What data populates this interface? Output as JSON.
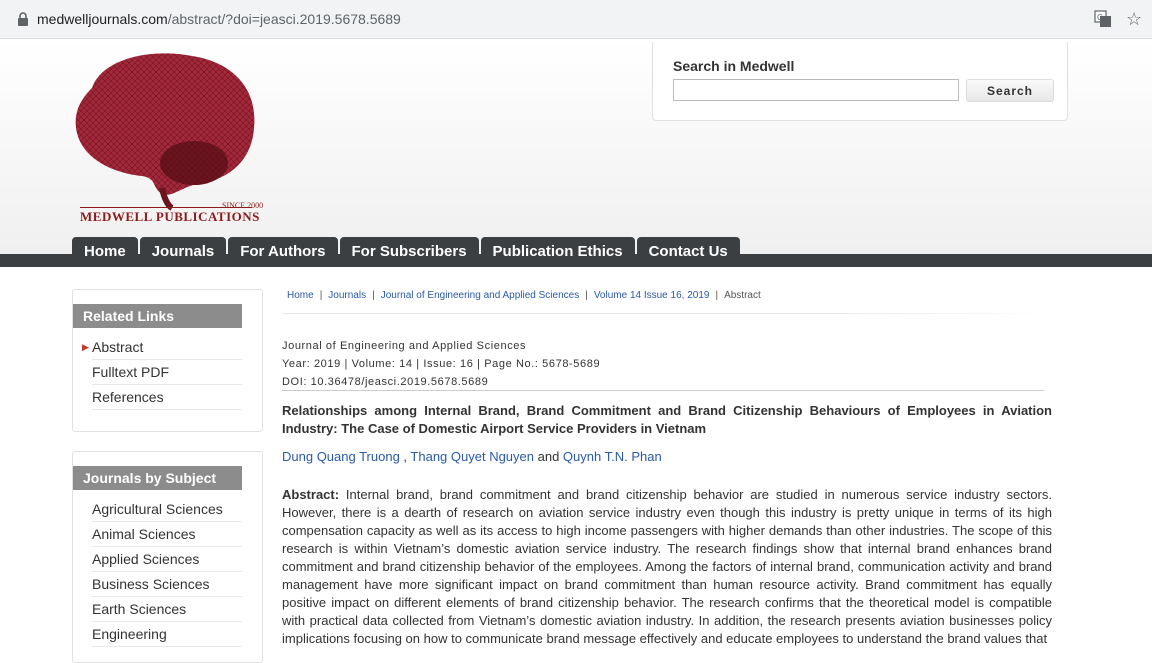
{
  "browser": {
    "url_host": "medwelljournals.com",
    "url_path": "/abstract/?doi=jeasci.2019.5678.5689"
  },
  "logo": {
    "since": "SINCE 2000",
    "name": "MEDWELL PUBLICATIONS"
  },
  "search": {
    "title": "Search in Medwell",
    "button": "Search",
    "value": ""
  },
  "nav": [
    "Home",
    "Journals",
    "For Authors",
    "For Subscribers",
    "Publication Ethics",
    "Contact Us"
  ],
  "related_links": {
    "title": "Related Links",
    "items": [
      "Abstract",
      "Fulltext PDF",
      "References"
    ]
  },
  "journals_by_subject": {
    "title": "Journals by Subject",
    "items": [
      "Agricultural Sciences",
      "Animal Sciences",
      "Applied Sciences",
      "Business Sciences",
      "Earth Sciences",
      "Engineering"
    ]
  },
  "breadcrumb": [
    "Home",
    "Journals",
    "Journal of Engineering and Applied Sciences",
    "Volume 14 Issue 16, 2019",
    "Abstract"
  ],
  "article": {
    "journal": "Journal of Engineering and Applied Sciences",
    "year_line": "Year: 2019 | Volume: 14 | Issue: 16 | Page No.: 5678-5689",
    "doi": "DOI: 10.36478/jeasci.2019.5678.5689",
    "title": "Relationships among Internal Brand, Brand Commitment and Brand Citizenship Behaviours of Employees in Aviation Industry: The Case of Domestic Airport Service Providers in Vietnam",
    "authors": [
      "Dung Quang Truong",
      "Thang Quyet Nguyen",
      "Quynh T.N. Phan"
    ],
    "author_sep": " , ",
    "author_and": " and ",
    "abstract_label": "Abstract:",
    "abstract_text": " Internal brand, brand commitment and brand citizenship behavior are studied in numerous service industry sectors. However, there is a dearth of research on aviation service industry even though this industry is pretty unique in terms of its high compensation capacity as well as its access to high income passengers with higher demands than other industries. The scope of this research is within Vietnam’s domestic aviation service industry. The research findings show that internal brand enhances brand commitment and brand citizenship behavior of the employees. Among the factors of internal brand, communication activity and brand management have more significant impact on brand commitment than human resource activity. Brand commitment has equally positive impact on different elements of brand citizenship behavior. The research confirms that the theoretical model is compatible with practical data collected from Vietnam’s domestic aviation industry. In addition, the research presents aviation businesses policy implications focusing on how to communicate brand message effectively and educate employees to understand the brand values that"
  },
  "colors": {
    "nav_bg": "#3b3f42",
    "panel_title_bg": "#8c8c8c",
    "link": "#2a5aa6",
    "brand": "#8a1c1c"
  }
}
